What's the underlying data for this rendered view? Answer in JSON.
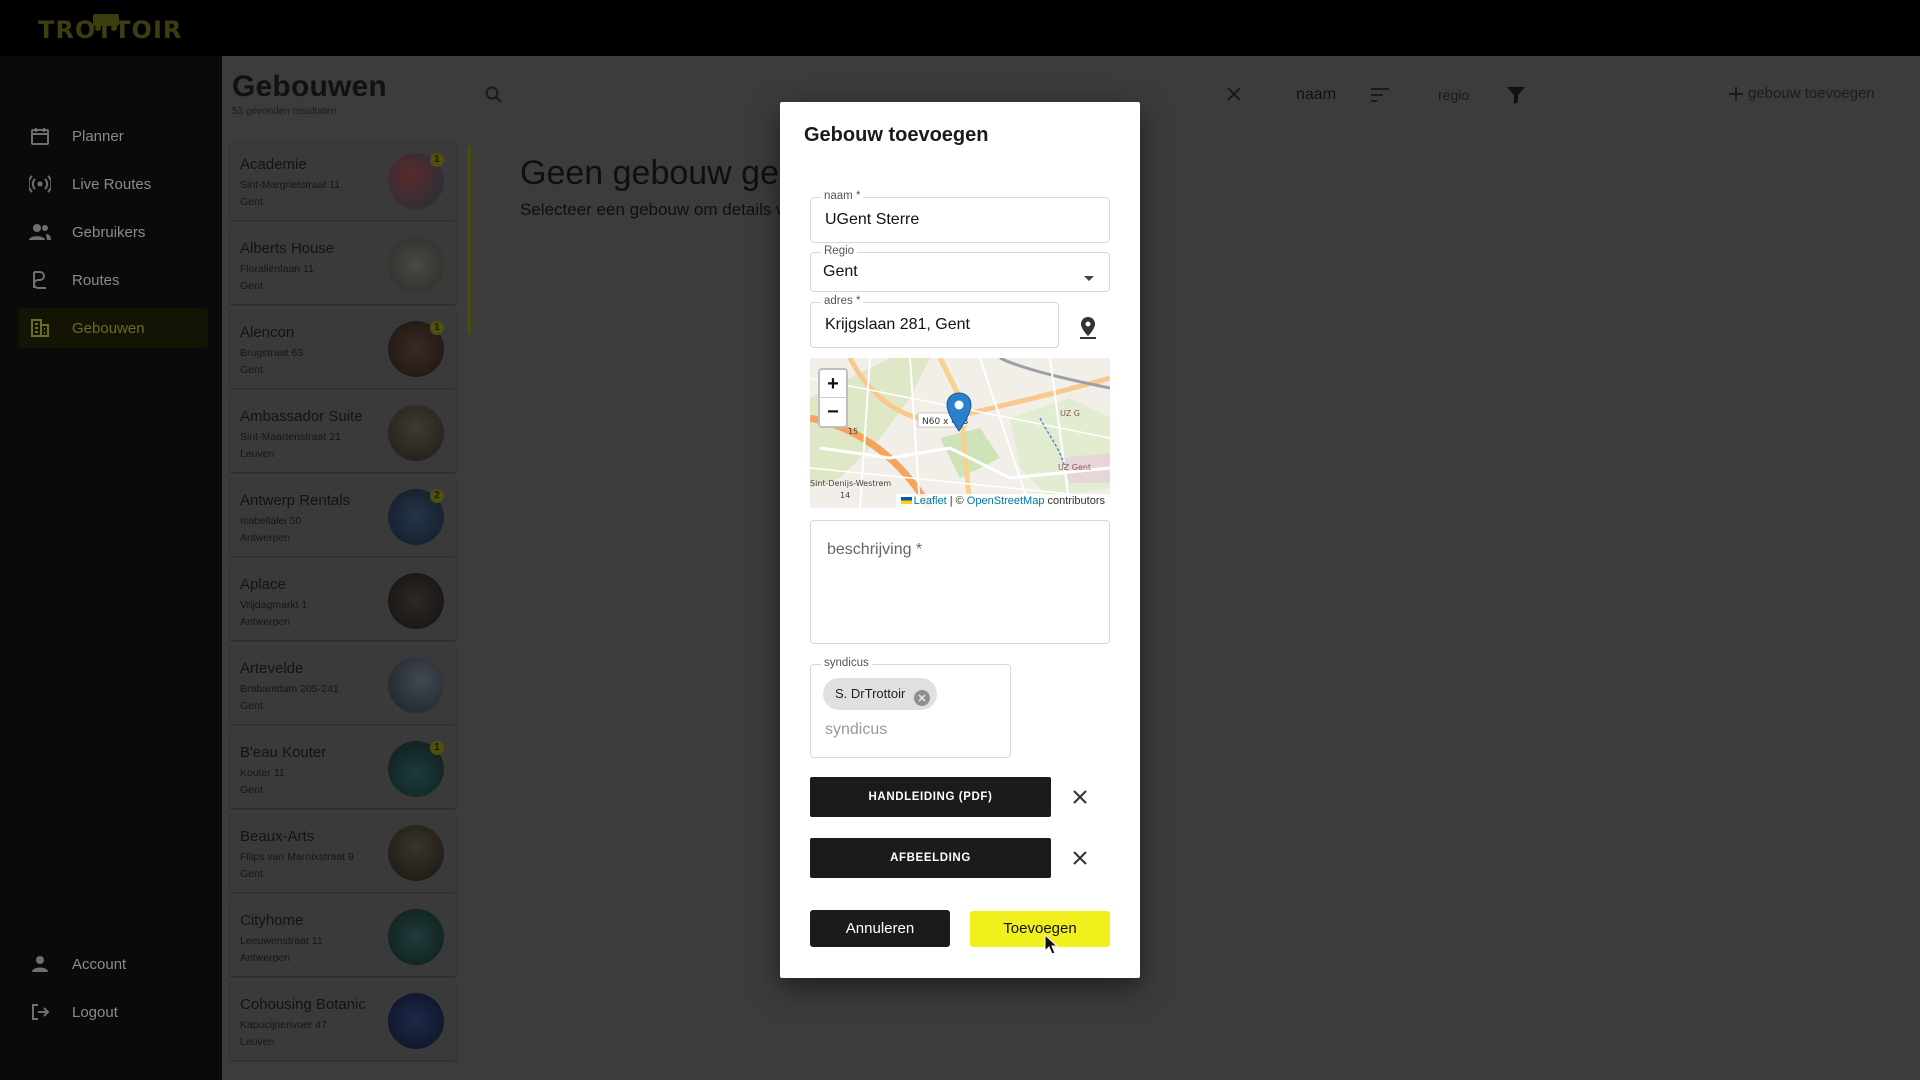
{
  "app": {
    "logo_text": "TROTTOIR"
  },
  "sidebar": {
    "items": [
      {
        "label": "Planner",
        "icon": "calendar-icon"
      },
      {
        "label": "Live Routes",
        "icon": "broadcast-icon"
      },
      {
        "label": "Gebruikers",
        "icon": "users-icon"
      },
      {
        "label": "Routes",
        "icon": "route-icon"
      },
      {
        "label": "Gebouwen",
        "icon": "buildings-icon",
        "active": true
      }
    ],
    "bottom": [
      {
        "label": "Account",
        "icon": "person-icon"
      },
      {
        "label": "Logout",
        "icon": "logout-icon"
      }
    ]
  },
  "list": {
    "title": "Gebouwen",
    "count": "53 gevonden resultaten",
    "sort_label": "naam",
    "filter_label": "regio",
    "add_label": "gebouw toevoegen",
    "items": [
      {
        "name": "Academie",
        "street": "Sint-Margrietstraat 11",
        "city": "Gent",
        "badge": "1"
      },
      {
        "name": "Alberts House",
        "street": "Floraliënlaan 11",
        "city": "Gent",
        "badge": ""
      },
      {
        "name": "Alencon",
        "street": "Brugstraat 63",
        "city": "Gent",
        "badge": "1"
      },
      {
        "name": "Ambassador Suite",
        "street": "Sint-Maartenstraat 21",
        "city": "Leuven",
        "badge": ""
      },
      {
        "name": "Antwerp Rentals",
        "street": "Isabellalei 50",
        "city": "Antwerpen",
        "badge": "2"
      },
      {
        "name": "Aplace",
        "street": "Vrijdagmarkt 1",
        "city": "Antwerpen",
        "badge": ""
      },
      {
        "name": "Artevelde",
        "street": "Brabantdam 205-241",
        "city": "Gent",
        "badge": ""
      },
      {
        "name": "B'eau Kouter",
        "street": "Kouter 11",
        "city": "Gent",
        "badge": "1"
      },
      {
        "name": "Beaux-Arts",
        "street": "Filips van Marnixstraat 9",
        "city": "Gent",
        "badge": ""
      },
      {
        "name": "Cityhome",
        "street": "Leeuwenstraat 11",
        "city": "Antwerpen",
        "badge": ""
      },
      {
        "name": "Cohousing Botanic",
        "street": "Kapucijnenvoer 47",
        "city": "Leuven",
        "badge": ""
      }
    ]
  },
  "detail": {
    "empty_title": "Geen gebouw geselecteerd",
    "empty_subtitle": "Selecteer een gebouw om details weer te geven"
  },
  "modal": {
    "title": "Gebouw toevoegen",
    "naam": {
      "label": "naam *",
      "value": "UGent Sterre"
    },
    "regio": {
      "label": "Regio",
      "value": "Gent"
    },
    "adres": {
      "label": "adres *",
      "value": "Krijgslaan 281, Gent"
    },
    "map": {
      "zoom_in": "+",
      "zoom_out": "−",
      "attribution_leaflet": "Leaflet",
      "attribution_sep": "| ©",
      "attribution_osm": "OpenStreetMap",
      "attribution_tail": "contributors",
      "labels": [
        "N60 x 433",
        "UZ Gent",
        "UZ G",
        "Sint-Denijs-Westrem",
        "14",
        "15"
      ]
    },
    "beschrijving": {
      "placeholder": "beschrijving *"
    },
    "syndicus": {
      "label": "syndicus",
      "chip": "S. DrTrottoir",
      "placeholder": "syndicus"
    },
    "file_buttons": [
      "HANDLEIDING (PDF)",
      "AFBEELDING"
    ],
    "cancel_label": "Annuleren",
    "submit_label": "Toevoegen"
  },
  "colors": {
    "accent": "#f0f01c",
    "backdrop": "#3c3c3c",
    "dark": "#1b1b1b"
  }
}
